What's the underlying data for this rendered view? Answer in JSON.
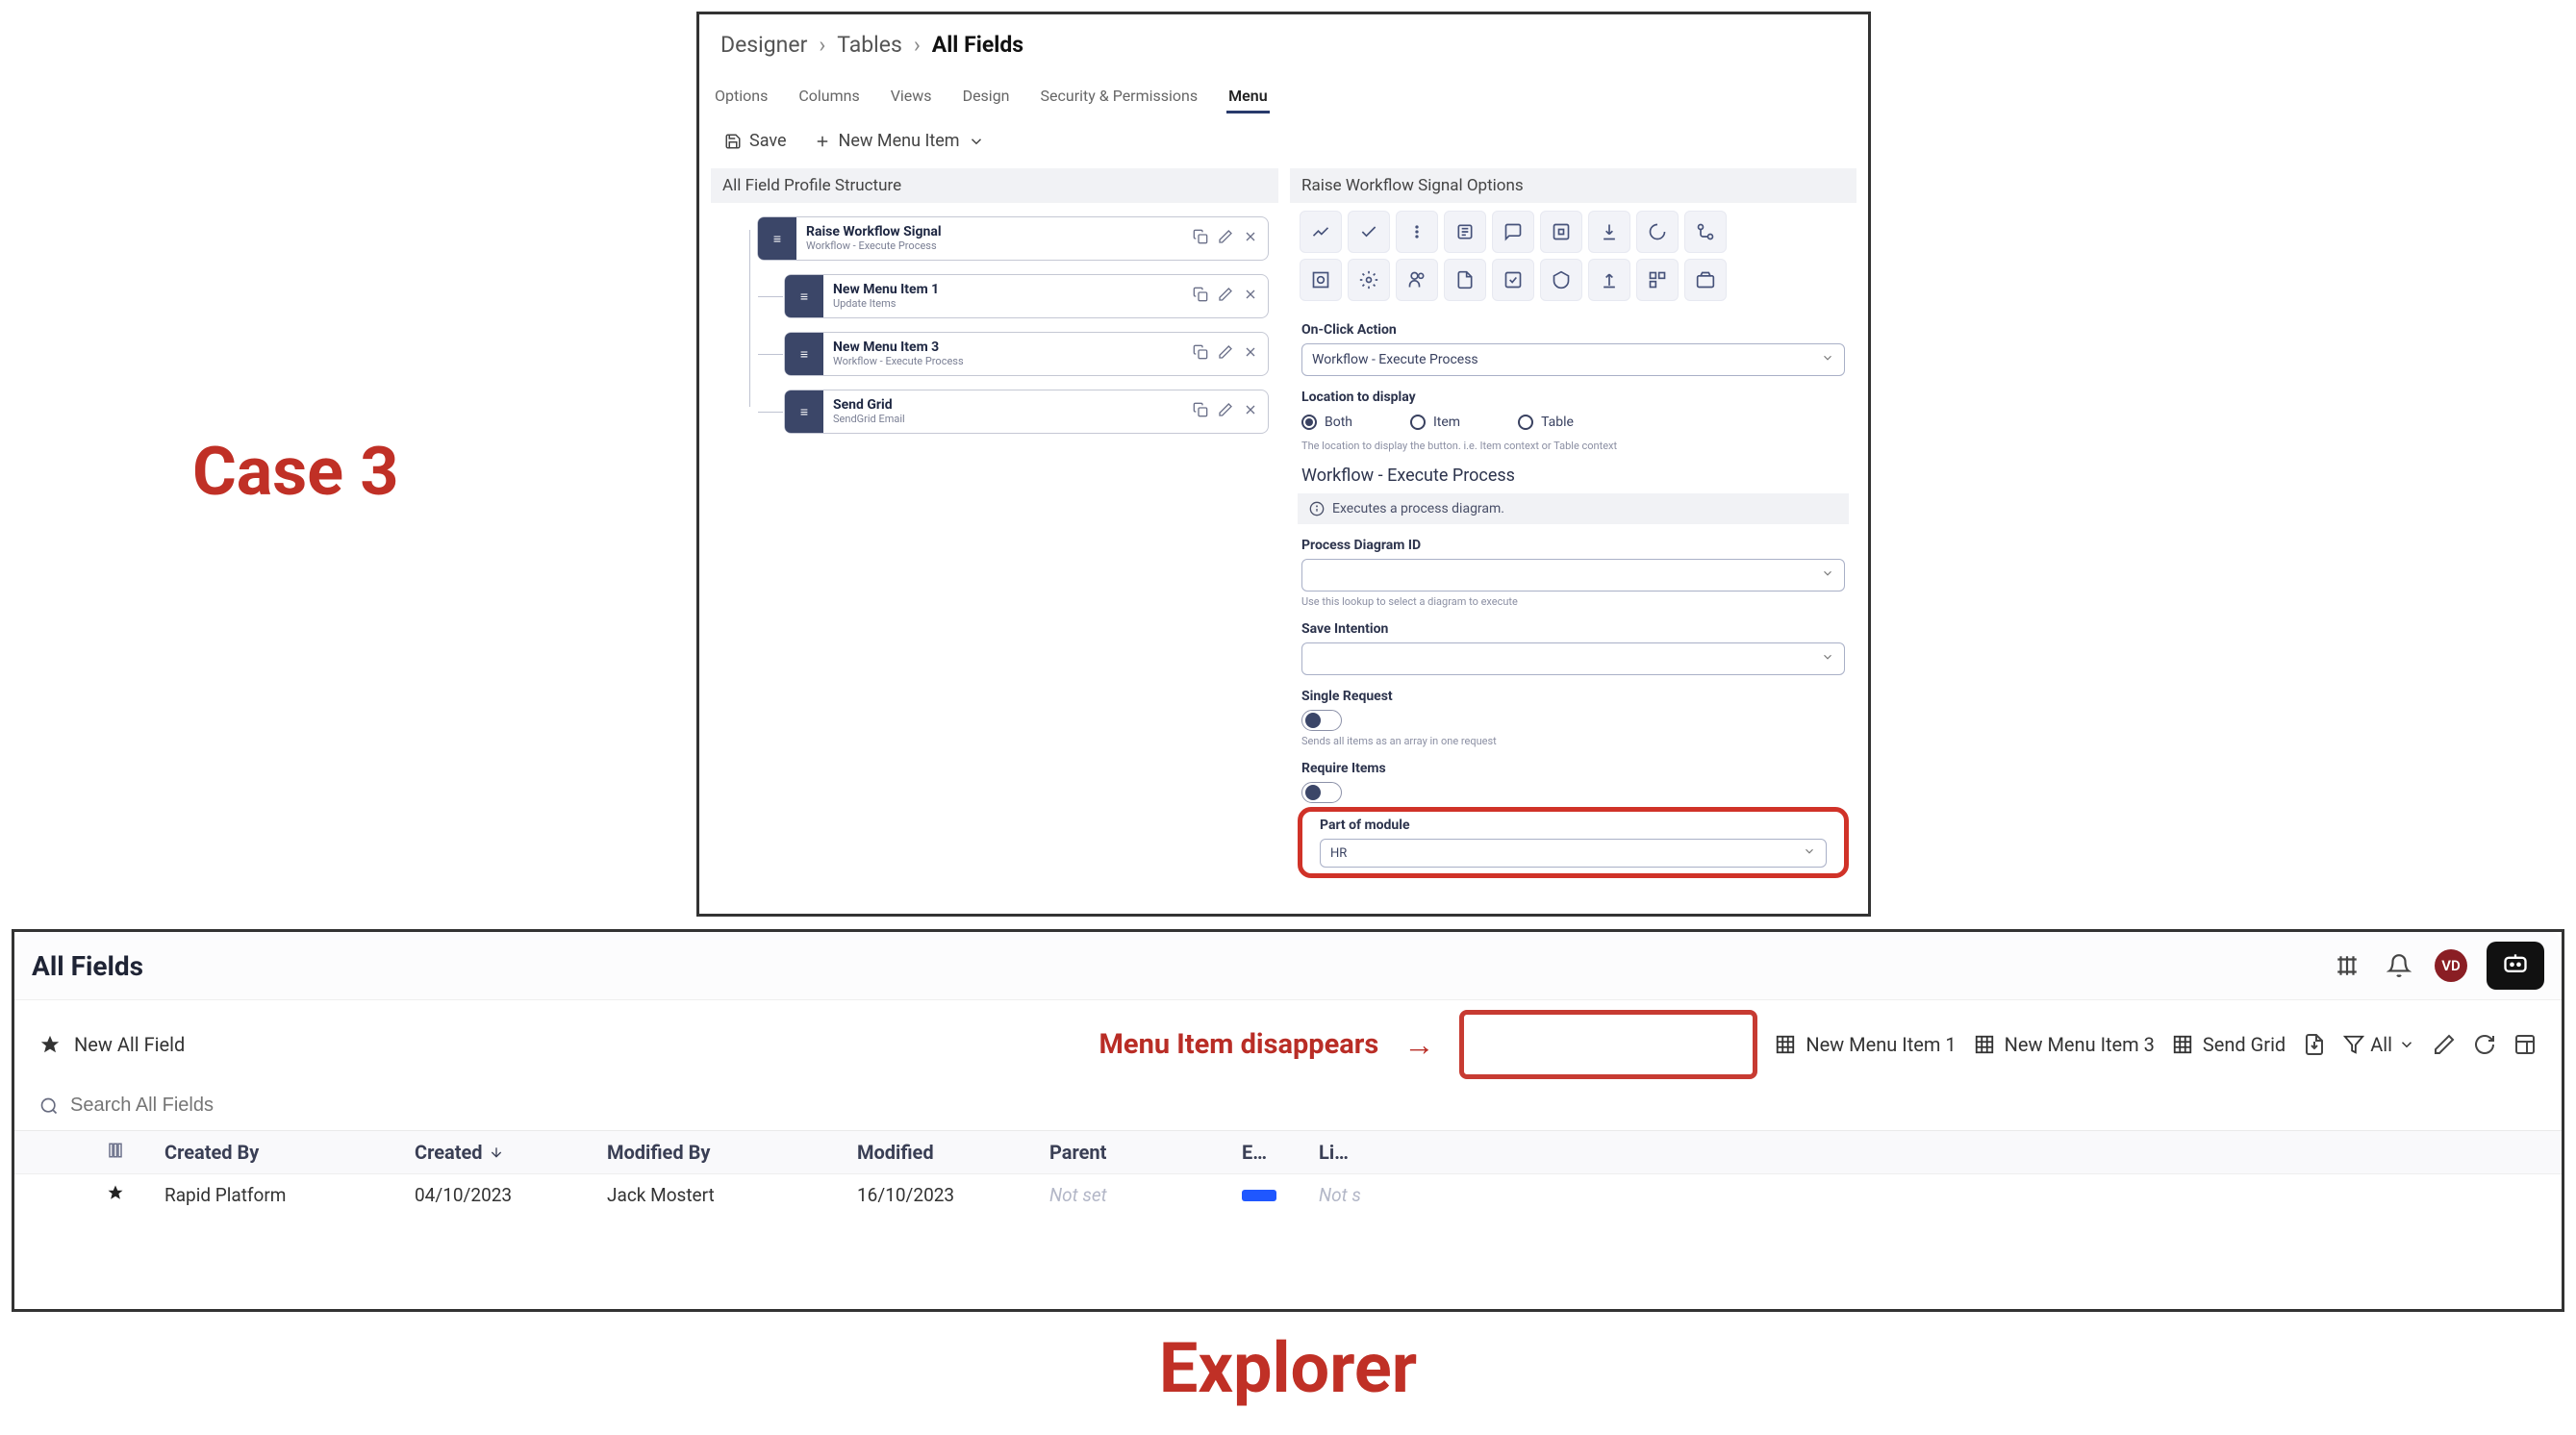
{
  "annotations": {
    "case": "Case 3",
    "explorer": "Explorer",
    "menu_disappears": "Menu Item disappears"
  },
  "designer": {
    "breadcrumb": [
      "Designer",
      "Tables",
      "All Fields"
    ],
    "tabs": [
      "Options",
      "Columns",
      "Views",
      "Design",
      "Security & Permissions",
      "Menu"
    ],
    "active_tab": "Menu",
    "actions": {
      "save": "Save",
      "new_menu": "New Menu Item"
    },
    "tree": {
      "title": "All Field Profile Structure",
      "items": [
        {
          "title": "Raise Workflow Signal",
          "sub": "Workflow - Execute Process"
        },
        {
          "title": "New Menu Item 1",
          "sub": "Update Items"
        },
        {
          "title": "New Menu Item 3",
          "sub": "Workflow - Execute Process"
        },
        {
          "title": "Send Grid",
          "sub": "SendGrid Email"
        }
      ]
    },
    "options": {
      "title": "Raise Workflow Signal Options",
      "onclick_label": "On-Click Action",
      "onclick_value": "Workflow - Execute Process",
      "location_label": "Location to display",
      "location_opts": [
        "Both",
        "Item",
        "Table"
      ],
      "location_selected": "Both",
      "location_help": "The location to display the button. i.e. Item context or Table context",
      "section": "Workflow - Execute Process",
      "info": "Executes a process diagram.",
      "process_label": "Process Diagram ID",
      "process_help": "Use this lookup to select a diagram to execute",
      "save_intention_label": "Save Intention",
      "single_request_label": "Single Request",
      "single_request_help": "Sends all items as an array in one request",
      "require_items_label": "Require Items",
      "module_label": "Part of module",
      "module_value": "HR"
    }
  },
  "explorer": {
    "title": "All Fields",
    "avatar": "VD",
    "toolbar": {
      "new_field": "New All Field",
      "menu1": "New Menu Item 1",
      "menu3": "New Menu Item 3",
      "sendgrid": "Send Grid",
      "filter": "All"
    },
    "search_placeholder": "Search All Fields",
    "columns": {
      "created_by": "Created By",
      "created": "Created",
      "modified_by": "Modified By",
      "modified": "Modified",
      "parent": "Parent",
      "e": "E…",
      "li": "Li…"
    },
    "row": {
      "created_by": "Rapid Platform",
      "created": "04/10/2023",
      "modified_by": "Jack Mostert",
      "modified": "16/10/2023",
      "parent": "Not set",
      "li": "Not s"
    }
  }
}
